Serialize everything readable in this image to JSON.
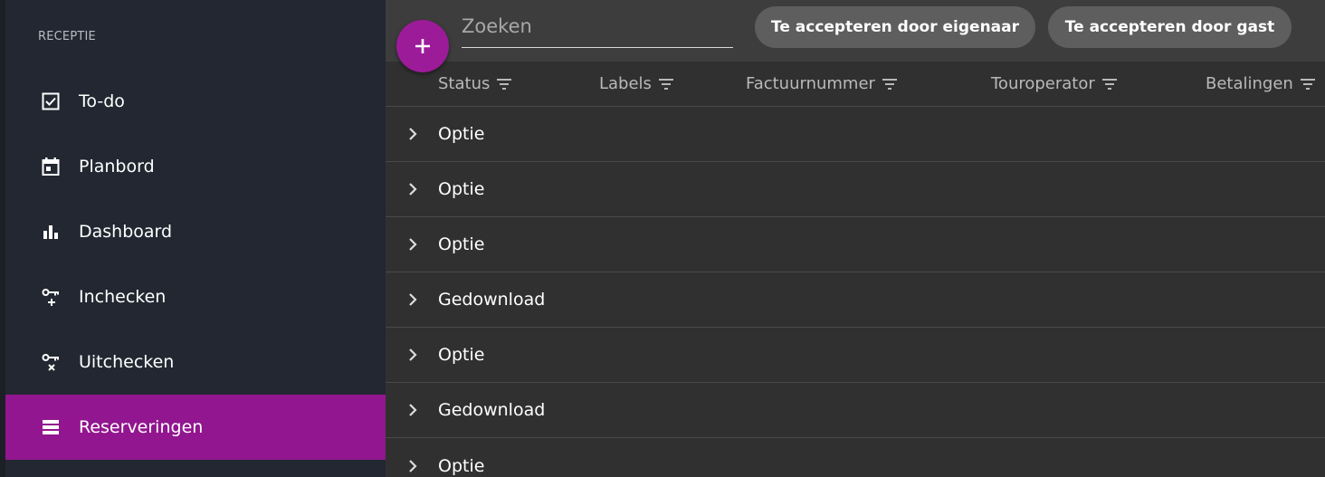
{
  "sidebar": {
    "header": "RECEPTIE",
    "items": [
      {
        "label": "To-do",
        "icon": "checkbox-icon",
        "active": false
      },
      {
        "label": "Planbord",
        "icon": "calendar-icon",
        "active": false
      },
      {
        "label": "Dashboard",
        "icon": "bar-chart-icon",
        "active": false
      },
      {
        "label": "Inchecken",
        "icon": "key-plus-icon",
        "active": false
      },
      {
        "label": "Uitchecken",
        "icon": "key-x-icon",
        "active": false
      },
      {
        "label": "Reserveringen",
        "icon": "list-icon",
        "active": true
      }
    ]
  },
  "search": {
    "placeholder": "Zoeken",
    "value": ""
  },
  "filters": [
    "Te accepteren door eigenaar",
    "Te accepteren door gast"
  ],
  "columns": [
    "Status",
    "Labels",
    "Factuurnummer",
    "Touroperator",
    "Betalingen"
  ],
  "rows": [
    {
      "status": "Optie"
    },
    {
      "status": "Optie"
    },
    {
      "status": "Optie"
    },
    {
      "status": "Gedownload"
    },
    {
      "status": "Optie"
    },
    {
      "status": "Gedownload"
    },
    {
      "status": "Optie"
    }
  ],
  "colors": {
    "accent": "#92168f",
    "sidebar": "#222731",
    "main": "#303030",
    "chip": "#5e5e5e"
  }
}
